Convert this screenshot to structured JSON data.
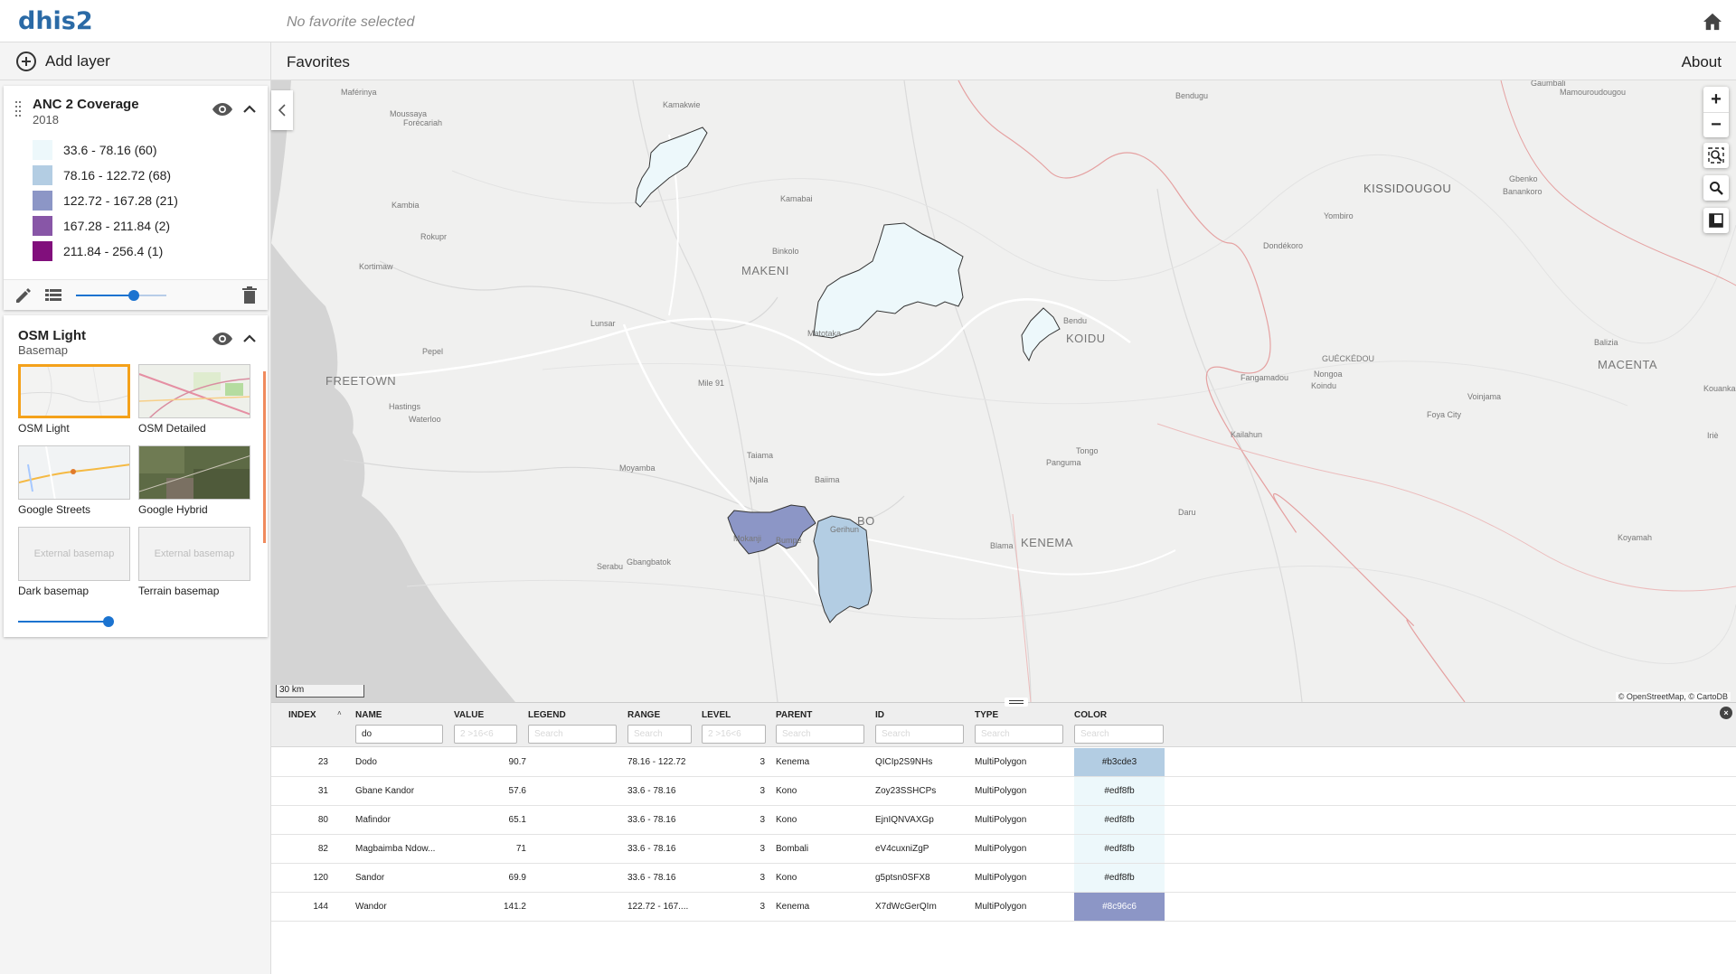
{
  "app": {
    "logo": "dhis2",
    "favorite_title": "No favorite selected"
  },
  "toolbar": {
    "add_layer": "Add layer",
    "favorites": "Favorites",
    "about": "About"
  },
  "thematic_layer": {
    "title": "ANC 2 Coverage",
    "period": "2018",
    "legend": [
      {
        "label": "33.6 - 78.16 (60)",
        "color": "#edf8fb"
      },
      {
        "label": "78.16 - 122.72 (68)",
        "color": "#b3cde3"
      },
      {
        "label": "122.72 - 167.28 (21)",
        "color": "#8c96c6"
      },
      {
        "label": "167.28 - 211.84 (2)",
        "color": "#8856a7"
      },
      {
        "label": "211.84 - 256.4 (1)",
        "color": "#810f7c"
      }
    ],
    "opacity": 0.8
  },
  "basemap_layer": {
    "title": "OSM Light",
    "subtitle": "Basemap",
    "options": [
      {
        "label": "OSM Light",
        "selected": true,
        "external": false
      },
      {
        "label": "OSM Detailed",
        "selected": false,
        "external": false
      },
      {
        "label": "Google Streets",
        "selected": false,
        "external": false
      },
      {
        "label": "Google Hybrid",
        "selected": false,
        "external": false
      },
      {
        "label": "Dark basemap",
        "selected": false,
        "external": true,
        "placeholder": "External basemap"
      },
      {
        "label": "Terrain basemap",
        "selected": false,
        "external": true,
        "placeholder": "External basemap"
      }
    ],
    "opacity": 1.0
  },
  "map": {
    "scale": "30 km",
    "attribution": "© OpenStreetMap, © CartoDB",
    "zoom_in": "+",
    "zoom_out": "−",
    "labels": [
      {
        "text": "Gaumbali",
        "cls": "place"
      },
      {
        "text": "Maférinya",
        "cls": "place"
      },
      {
        "text": "Bendugu",
        "cls": "place"
      },
      {
        "text": "Mamouroudougou",
        "cls": "place"
      },
      {
        "text": "Kamakwie",
        "cls": "place"
      },
      {
        "text": "Moussaya",
        "cls": "place"
      },
      {
        "text": "Forécariah",
        "cls": "place"
      },
      {
        "text": "Kamabai",
        "cls": "place"
      },
      {
        "text": "KISSIDOUGOU",
        "cls": "place big"
      },
      {
        "text": "Gbenko",
        "cls": "place"
      },
      {
        "text": "Banankoro",
        "cls": "place"
      },
      {
        "text": "Kambia",
        "cls": "place"
      },
      {
        "text": "Yombiro",
        "cls": "place"
      },
      {
        "text": "Rokupr",
        "cls": "place"
      },
      {
        "text": "Dondékoro",
        "cls": "place"
      },
      {
        "text": "Binkolo",
        "cls": "place"
      },
      {
        "text": "MAKENI",
        "cls": "place city"
      },
      {
        "text": "Kortimaw",
        "cls": "place"
      },
      {
        "text": "Lunsar",
        "cls": "place"
      },
      {
        "text": "Bendu",
        "cls": "place"
      },
      {
        "text": "KOIDU",
        "cls": "place city"
      },
      {
        "text": "Matotaka",
        "cls": "place"
      },
      {
        "text": "Balizia",
        "cls": "place"
      },
      {
        "text": "Pepel",
        "cls": "place"
      },
      {
        "text": "GUÉCKÉDOU",
        "cls": "place"
      },
      {
        "text": "MACENTA",
        "cls": "place city"
      },
      {
        "text": "Fangamadou",
        "cls": "place"
      },
      {
        "text": "Nongoa",
        "cls": "place"
      },
      {
        "text": "Koindu",
        "cls": "place"
      },
      {
        "text": "FREETOWN",
        "cls": "place city"
      },
      {
        "text": "Mile 91",
        "cls": "place"
      },
      {
        "text": "Kouankan",
        "cls": "place"
      },
      {
        "text": "Voinjama",
        "cls": "place"
      },
      {
        "text": "Hastings",
        "cls": "place"
      },
      {
        "text": "Foya City",
        "cls": "place"
      },
      {
        "text": "Waterloo",
        "cls": "place"
      },
      {
        "text": "Kailahun",
        "cls": "place"
      },
      {
        "text": "Iriè",
        "cls": "place"
      },
      {
        "text": "Tongo",
        "cls": "place"
      },
      {
        "text": "Panguma",
        "cls": "place"
      },
      {
        "text": "Taiama",
        "cls": "place"
      },
      {
        "text": "Moyamba",
        "cls": "place"
      },
      {
        "text": "Njala",
        "cls": "place"
      },
      {
        "text": "Baiima",
        "cls": "place"
      },
      {
        "text": "Daru",
        "cls": "place"
      },
      {
        "text": "BO",
        "cls": "place city"
      },
      {
        "text": "Gerihun",
        "cls": "place"
      },
      {
        "text": "Mokanji",
        "cls": "place"
      },
      {
        "text": "Bumpe",
        "cls": "place"
      },
      {
        "text": "KENEMA",
        "cls": "place city"
      },
      {
        "text": "Blama",
        "cls": "place"
      },
      {
        "text": "Koyamah",
        "cls": "place"
      },
      {
        "text": "Gbangbatok",
        "cls": "place"
      },
      {
        "text": "Serabu",
        "cls": "place"
      }
    ]
  },
  "table": {
    "columns": [
      {
        "key": "index",
        "label": "INDEX",
        "filter_value": "",
        "placeholder": ""
      },
      {
        "key": "name",
        "label": "NAME",
        "filter_value": "do",
        "placeholder": "Search"
      },
      {
        "key": "value",
        "label": "VALUE",
        "filter_value": "",
        "placeholder": "2 >16<6"
      },
      {
        "key": "legend",
        "label": "LEGEND",
        "filter_value": "",
        "placeholder": "Search"
      },
      {
        "key": "range",
        "label": "RANGE",
        "filter_value": "",
        "placeholder": "Search"
      },
      {
        "key": "level",
        "label": "LEVEL",
        "filter_value": "",
        "placeholder": "2 >16<6"
      },
      {
        "key": "parent",
        "label": "PARENT",
        "filter_value": "",
        "placeholder": "Search"
      },
      {
        "key": "id",
        "label": "ID",
        "filter_value": "",
        "placeholder": "Search"
      },
      {
        "key": "type",
        "label": "TYPE",
        "filter_value": "",
        "placeholder": "Search"
      },
      {
        "key": "color",
        "label": "COLOR",
        "filter_value": "",
        "placeholder": "Search"
      }
    ],
    "sort_indicator": "˄",
    "close": "×",
    "rows": [
      {
        "index": "23",
        "name": "Dodo",
        "value": "90.7",
        "legend": "",
        "range": "78.16 - 122.72",
        "level": "3",
        "parent": "Kenema",
        "id": "QICIp2S9NHs",
        "type": "MultiPolygon",
        "color": "#b3cde3",
        "text_color": "#222222"
      },
      {
        "index": "31",
        "name": "Gbane Kandor",
        "value": "57.6",
        "legend": "",
        "range": "33.6 - 78.16",
        "level": "3",
        "parent": "Kono",
        "id": "Zoy23SSHCPs",
        "type": "MultiPolygon",
        "color": "#edf8fb",
        "text_color": "#222222"
      },
      {
        "index": "80",
        "name": "Mafindor",
        "value": "65.1",
        "legend": "",
        "range": "33.6 - 78.16",
        "level": "3",
        "parent": "Kono",
        "id": "EjnIQNVAXGp",
        "type": "MultiPolygon",
        "color": "#edf8fb",
        "text_color": "#222222"
      },
      {
        "index": "82",
        "name": "Magbaimba Ndow...",
        "value": "71",
        "legend": "",
        "range": "33.6 - 78.16",
        "level": "3",
        "parent": "Bombali",
        "id": "eV4cuxniZgP",
        "type": "MultiPolygon",
        "color": "#edf8fb",
        "text_color": "#222222"
      },
      {
        "index": "120",
        "name": "Sandor",
        "value": "69.9",
        "legend": "",
        "range": "33.6 - 78.16",
        "level": "3",
        "parent": "Kono",
        "id": "g5ptsn0SFX8",
        "type": "MultiPolygon",
        "color": "#edf8fb",
        "text_color": "#222222"
      },
      {
        "index": "144",
        "name": "Wandor",
        "value": "141.2",
        "legend": "",
        "range": "122.72 - 167....",
        "level": "3",
        "parent": "Kenema",
        "id": "X7dWcGerQIm",
        "type": "MultiPolygon",
        "color": "#8c96c6",
        "text_color": "#ffffff"
      }
    ]
  }
}
